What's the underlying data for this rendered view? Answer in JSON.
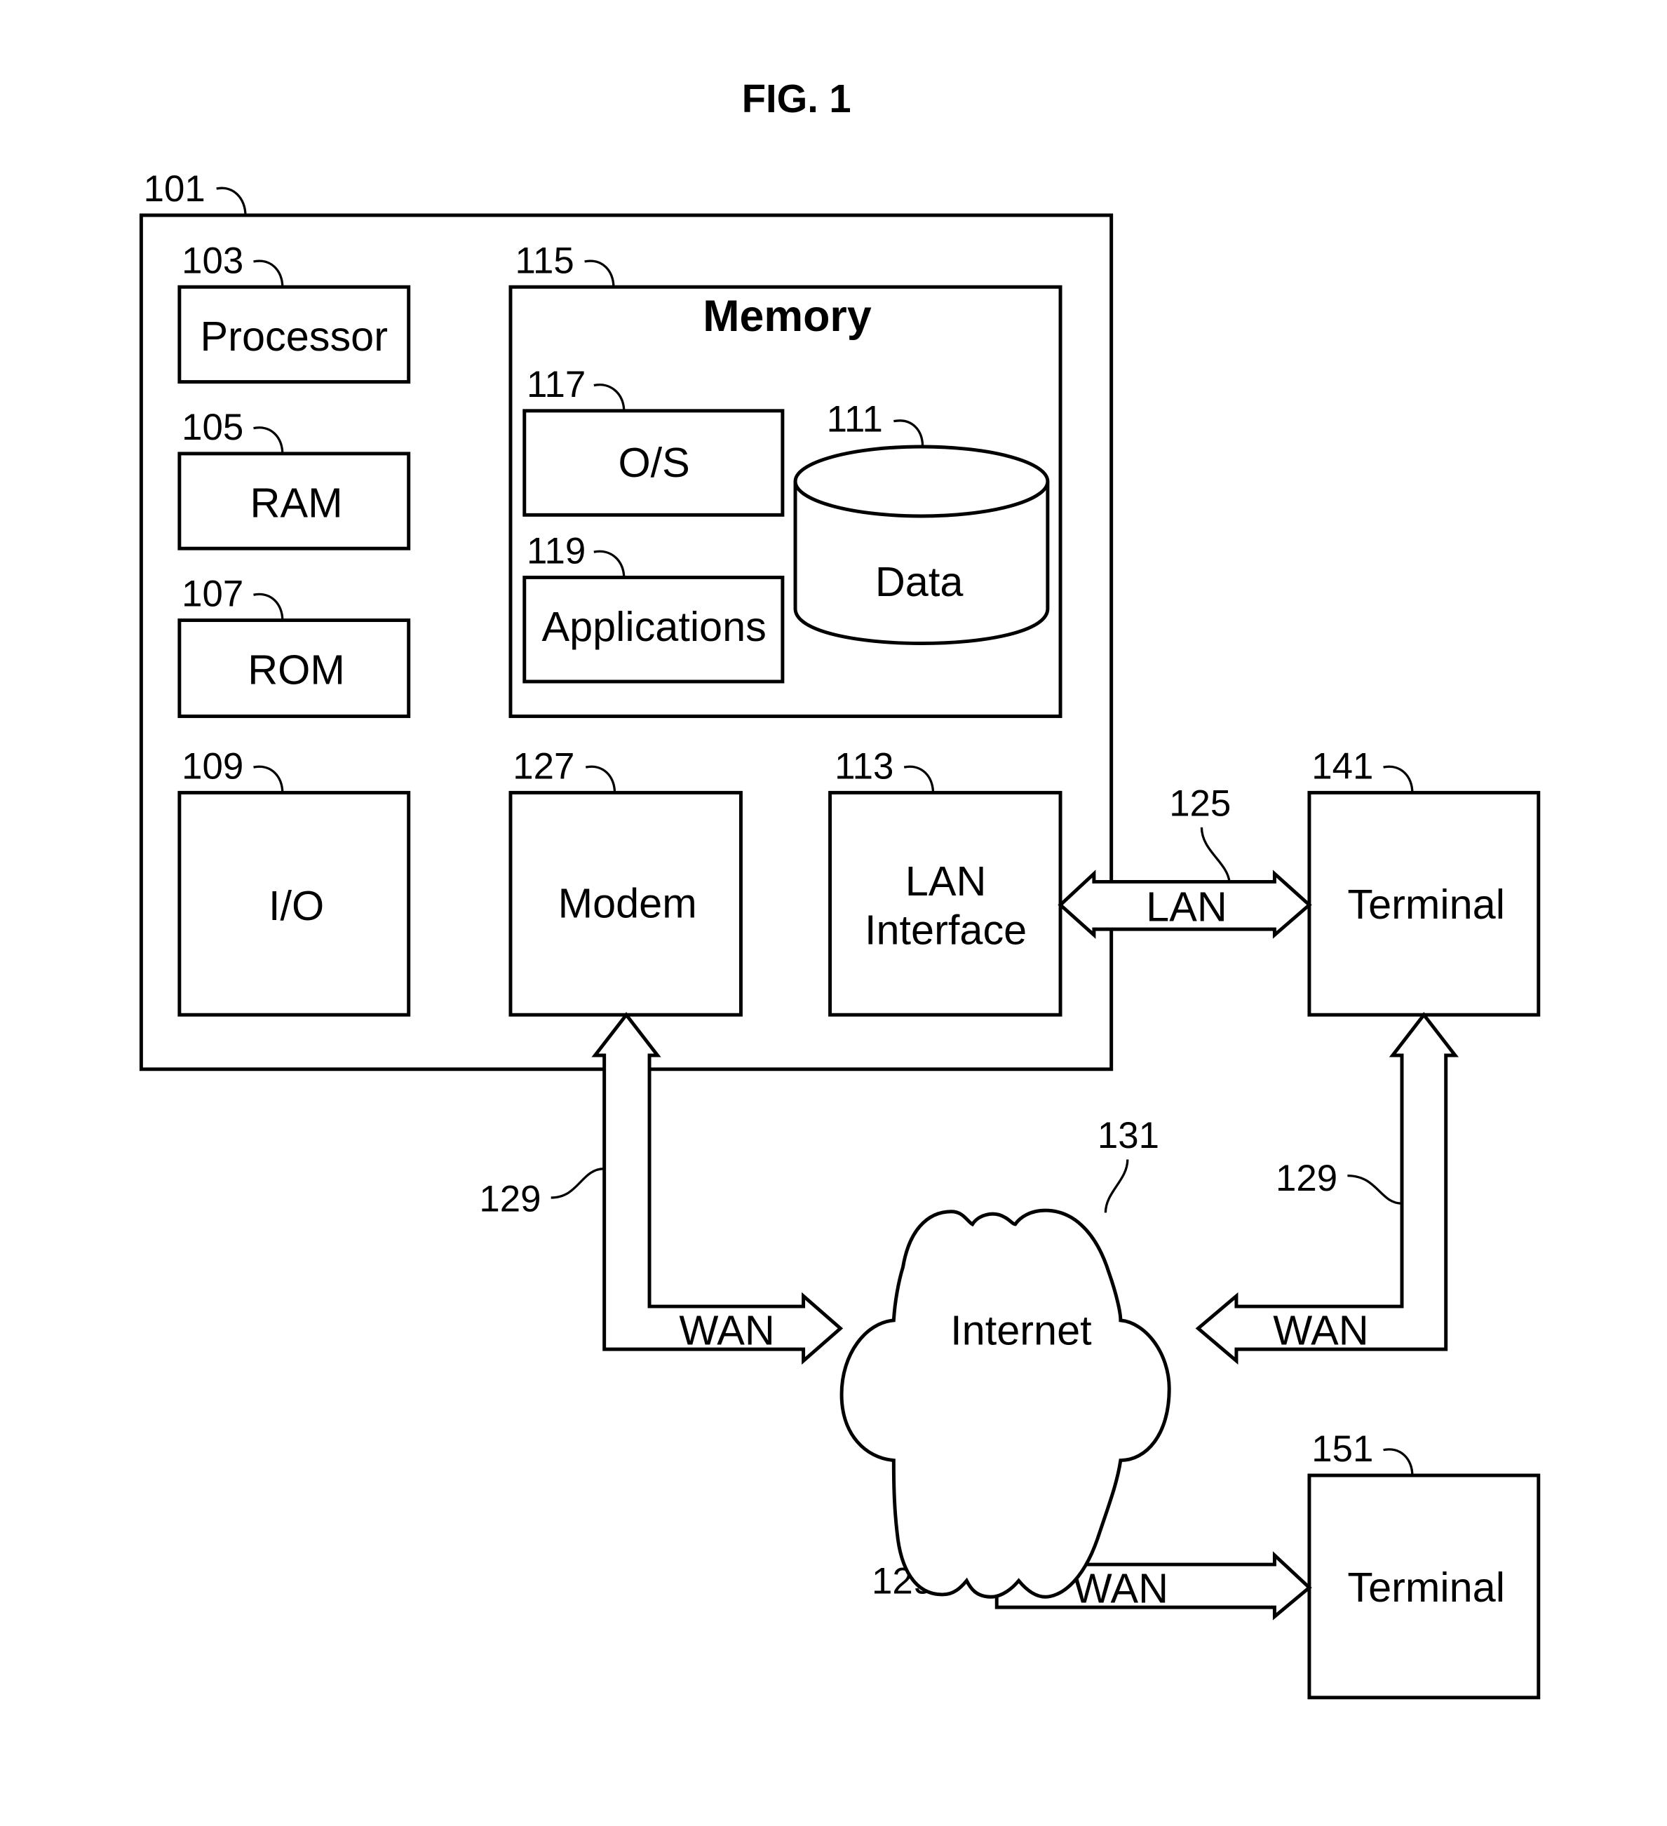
{
  "figure": {
    "title": "FIG. 1"
  },
  "components": {
    "computer": {
      "ref": "101"
    },
    "processor": {
      "ref": "103",
      "label": "Processor"
    },
    "ram": {
      "ref": "105",
      "label": "RAM"
    },
    "rom": {
      "ref": "107",
      "label": "ROM"
    },
    "io": {
      "ref": "109",
      "label": "I/O"
    },
    "memory": {
      "ref": "115",
      "label": "Memory"
    },
    "os": {
      "ref": "117",
      "label": "O/S"
    },
    "applications": {
      "ref": "119",
      "label": "Applications"
    },
    "data": {
      "ref": "111",
      "label": "Data"
    },
    "modem": {
      "ref": "127",
      "label": "Modem"
    },
    "lan_interface": {
      "ref": "113",
      "label_line1": "LAN",
      "label_line2": "Interface"
    },
    "terminal_141": {
      "ref": "141",
      "label": "Terminal"
    },
    "terminal_151": {
      "ref": "151",
      "label": "Terminal"
    },
    "internet": {
      "ref": "131",
      "label": "Internet"
    }
  },
  "connections": {
    "lan": {
      "ref": "125",
      "label": "LAN"
    },
    "wan_modem": {
      "ref": "129",
      "label": "WAN"
    },
    "wan_terminal_141": {
      "ref": "129",
      "label": "WAN"
    },
    "wan_terminal_151": {
      "ref": "129",
      "label": "WAN"
    }
  }
}
